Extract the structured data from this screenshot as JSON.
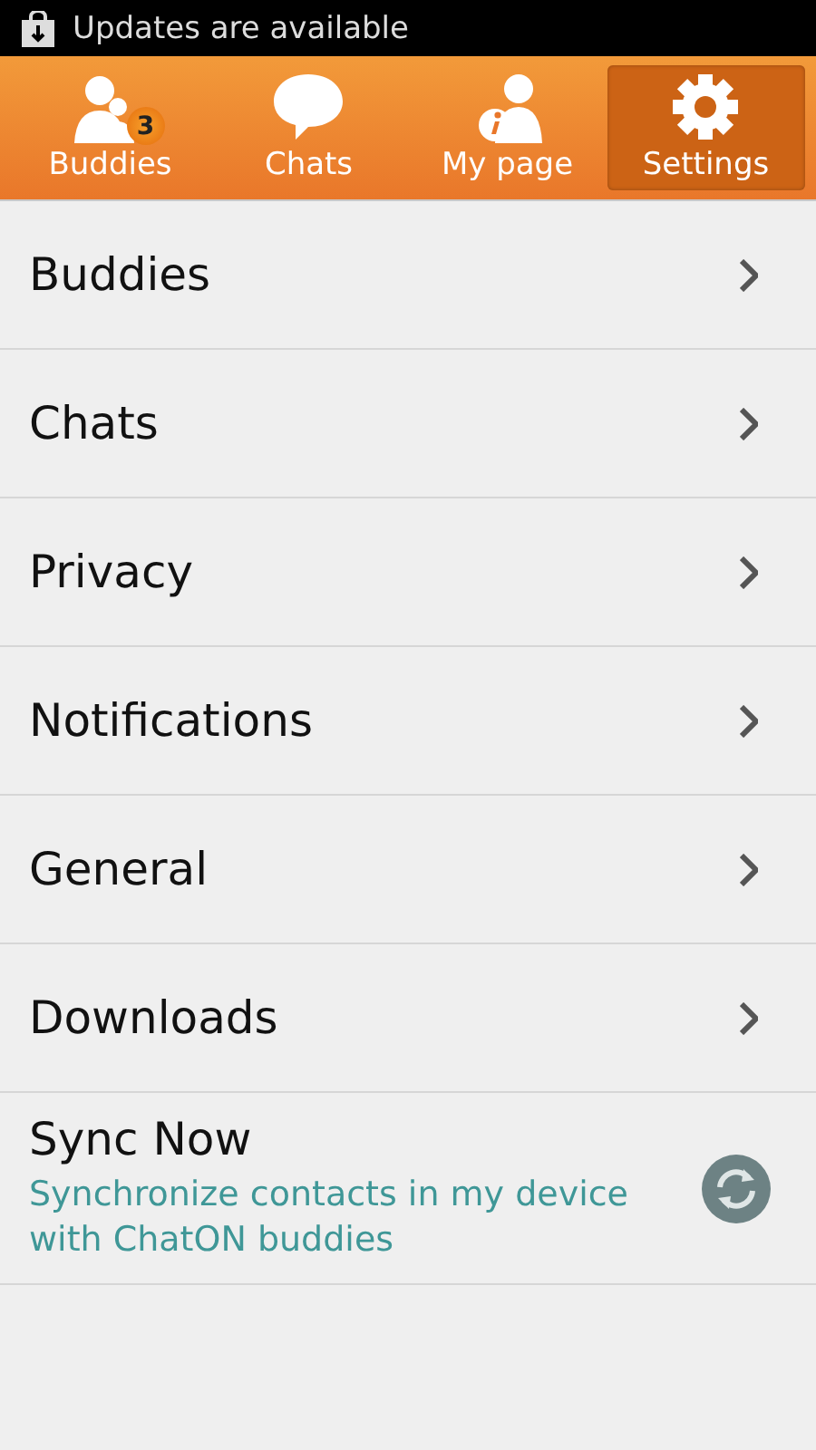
{
  "status_bar": {
    "notification": "Updates are available"
  },
  "tabs": [
    {
      "kind": "buddies",
      "label": "Buddies",
      "badge": "3",
      "selected": false
    },
    {
      "kind": "chats",
      "label": "Chats",
      "selected": false
    },
    {
      "kind": "mypage",
      "label": "My page",
      "selected": false
    },
    {
      "kind": "settings",
      "label": "Settings",
      "selected": true
    }
  ],
  "menu": [
    {
      "label": "Buddies"
    },
    {
      "label": "Chats"
    },
    {
      "label": "Privacy"
    },
    {
      "label": "Notifications"
    },
    {
      "label": "General"
    },
    {
      "label": "Downloads"
    }
  ],
  "sync": {
    "title": "Sync Now",
    "description": "Synchronize contacts in my device with ChatON buddies"
  }
}
